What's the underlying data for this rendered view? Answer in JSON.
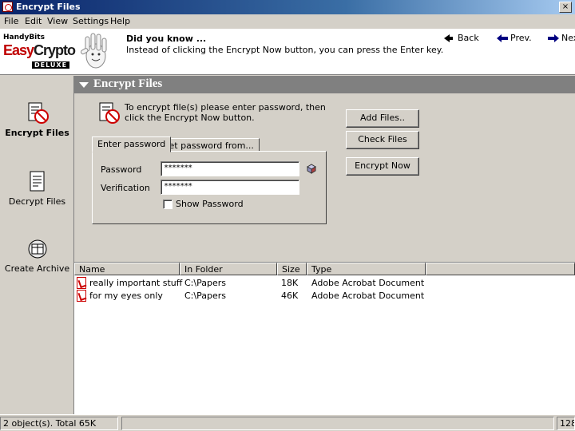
{
  "window": {
    "title": "Encrypt Files",
    "close_glyph": "×"
  },
  "menu": [
    "File",
    "Edit",
    "View",
    "Settings",
    "Help"
  ],
  "brand": {
    "company": "HandyBits",
    "product_part1": "Easy",
    "product_part2": "Crypto",
    "edition": "DELUXE"
  },
  "tip": {
    "title": "Did you know ...",
    "text": "Instead of clicking the Encrypt Now button, you can press the Enter key."
  },
  "nav": {
    "back": "Back",
    "prev": "Prev.",
    "next": "Nex"
  },
  "sidebar": [
    {
      "label": "Encrypt Files",
      "icon": "encrypt-icon",
      "active": true
    },
    {
      "label": "Decrypt Files",
      "icon": "decrypt-icon",
      "active": false
    },
    {
      "label": "Create Archive",
      "icon": "archive-icon",
      "active": false
    }
  ],
  "section": {
    "title": "Encrypt Files"
  },
  "form": {
    "instructions": "To encrypt file(s) please enter password, then click the Encrypt Now button.",
    "tabs": [
      "Enter password",
      "Get password from..."
    ],
    "password_label": "Password",
    "password_value": "*******",
    "verification_label": "Verification",
    "verification_value": "*******",
    "show_password_label": "Show Password",
    "show_password_checked": false
  },
  "buttons": {
    "add_files": "Add Files..",
    "check_files": "Check Files",
    "encrypt_now": "Encrypt Now"
  },
  "list": {
    "columns": [
      "Name",
      "In Folder",
      "Size",
      "Type"
    ],
    "rows": [
      {
        "name": "really important stuff",
        "folder": "C:\\Papers",
        "size": "18K",
        "type": "Adobe Acrobat Document"
      },
      {
        "name": "for my eyes only",
        "folder": "C:\\Papers",
        "size": "46K",
        "type": "Adobe Acrobat Document"
      }
    ]
  },
  "status": {
    "summary": "2 object(s). Total 65K",
    "right": "128"
  },
  "colors": {
    "titlebar": "#0a246a",
    "face": "#d4d0c8",
    "section_header": "#808080",
    "brand_red": "#c00000"
  }
}
